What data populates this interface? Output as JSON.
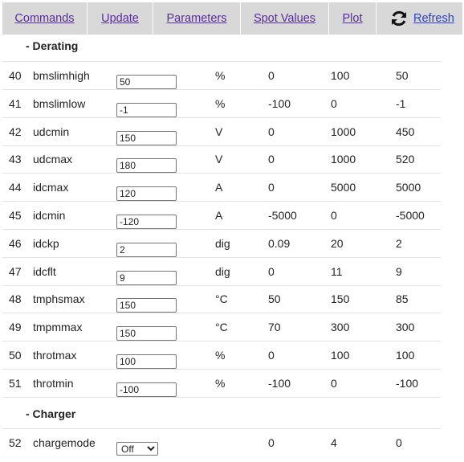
{
  "nav": {
    "commands": "Commands",
    "update": "Update",
    "parameters": "Parameters",
    "spot_values": "Spot Values",
    "plot": "Plot",
    "refresh": "Refresh",
    "refresh_icon": "refresh-icon"
  },
  "sections": {
    "derating": "- Derating",
    "charger": "- Charger"
  },
  "params": [
    {
      "idx": "40",
      "name": "bmslimhigh",
      "value": "50",
      "unit": "%",
      "min": "0",
      "max": "100",
      "default": "50"
    },
    {
      "idx": "41",
      "name": "bmslimlow",
      "value": "-1",
      "unit": "%",
      "min": "-100",
      "max": "0",
      "default": "-1"
    },
    {
      "idx": "42",
      "name": "udcmin",
      "value": "150",
      "unit": "V",
      "min": "0",
      "max": "1000",
      "default": "450"
    },
    {
      "idx": "43",
      "name": "udcmax",
      "value": "180",
      "unit": "V",
      "min": "0",
      "max": "1000",
      "default": "520"
    },
    {
      "idx": "44",
      "name": "idcmax",
      "value": "120",
      "unit": "A",
      "min": "0",
      "max": "5000",
      "default": "5000"
    },
    {
      "idx": "45",
      "name": "idcmin",
      "value": "-120",
      "unit": "A",
      "min": "-5000",
      "max": "0",
      "default": "-5000"
    },
    {
      "idx": "46",
      "name": "idckp",
      "value": "2",
      "unit": "dig",
      "min": "0.09",
      "max": "20",
      "default": "2"
    },
    {
      "idx": "47",
      "name": "idcflt",
      "value": "9",
      "unit": "dig",
      "min": "0",
      "max": "11",
      "default": "9"
    },
    {
      "idx": "48",
      "name": "tmphsmax",
      "value": "150",
      "unit": "°C",
      "min": "50",
      "max": "150",
      "default": "85"
    },
    {
      "idx": "49",
      "name": "tmpmmax",
      "value": "150",
      "unit": "°C",
      "min": "70",
      "max": "300",
      "default": "300"
    },
    {
      "idx": "50",
      "name": "throtmax",
      "value": "100",
      "unit": "%",
      "min": "0",
      "max": "100",
      "default": "100"
    },
    {
      "idx": "51",
      "name": "throtmin",
      "value": "-100",
      "unit": "%",
      "min": "-100",
      "max": "0",
      "default": "-100"
    }
  ],
  "charger": {
    "idx": "52",
    "name": "chargemode",
    "selected": "Off",
    "min": "0",
    "max": "4",
    "default": "0"
  }
}
